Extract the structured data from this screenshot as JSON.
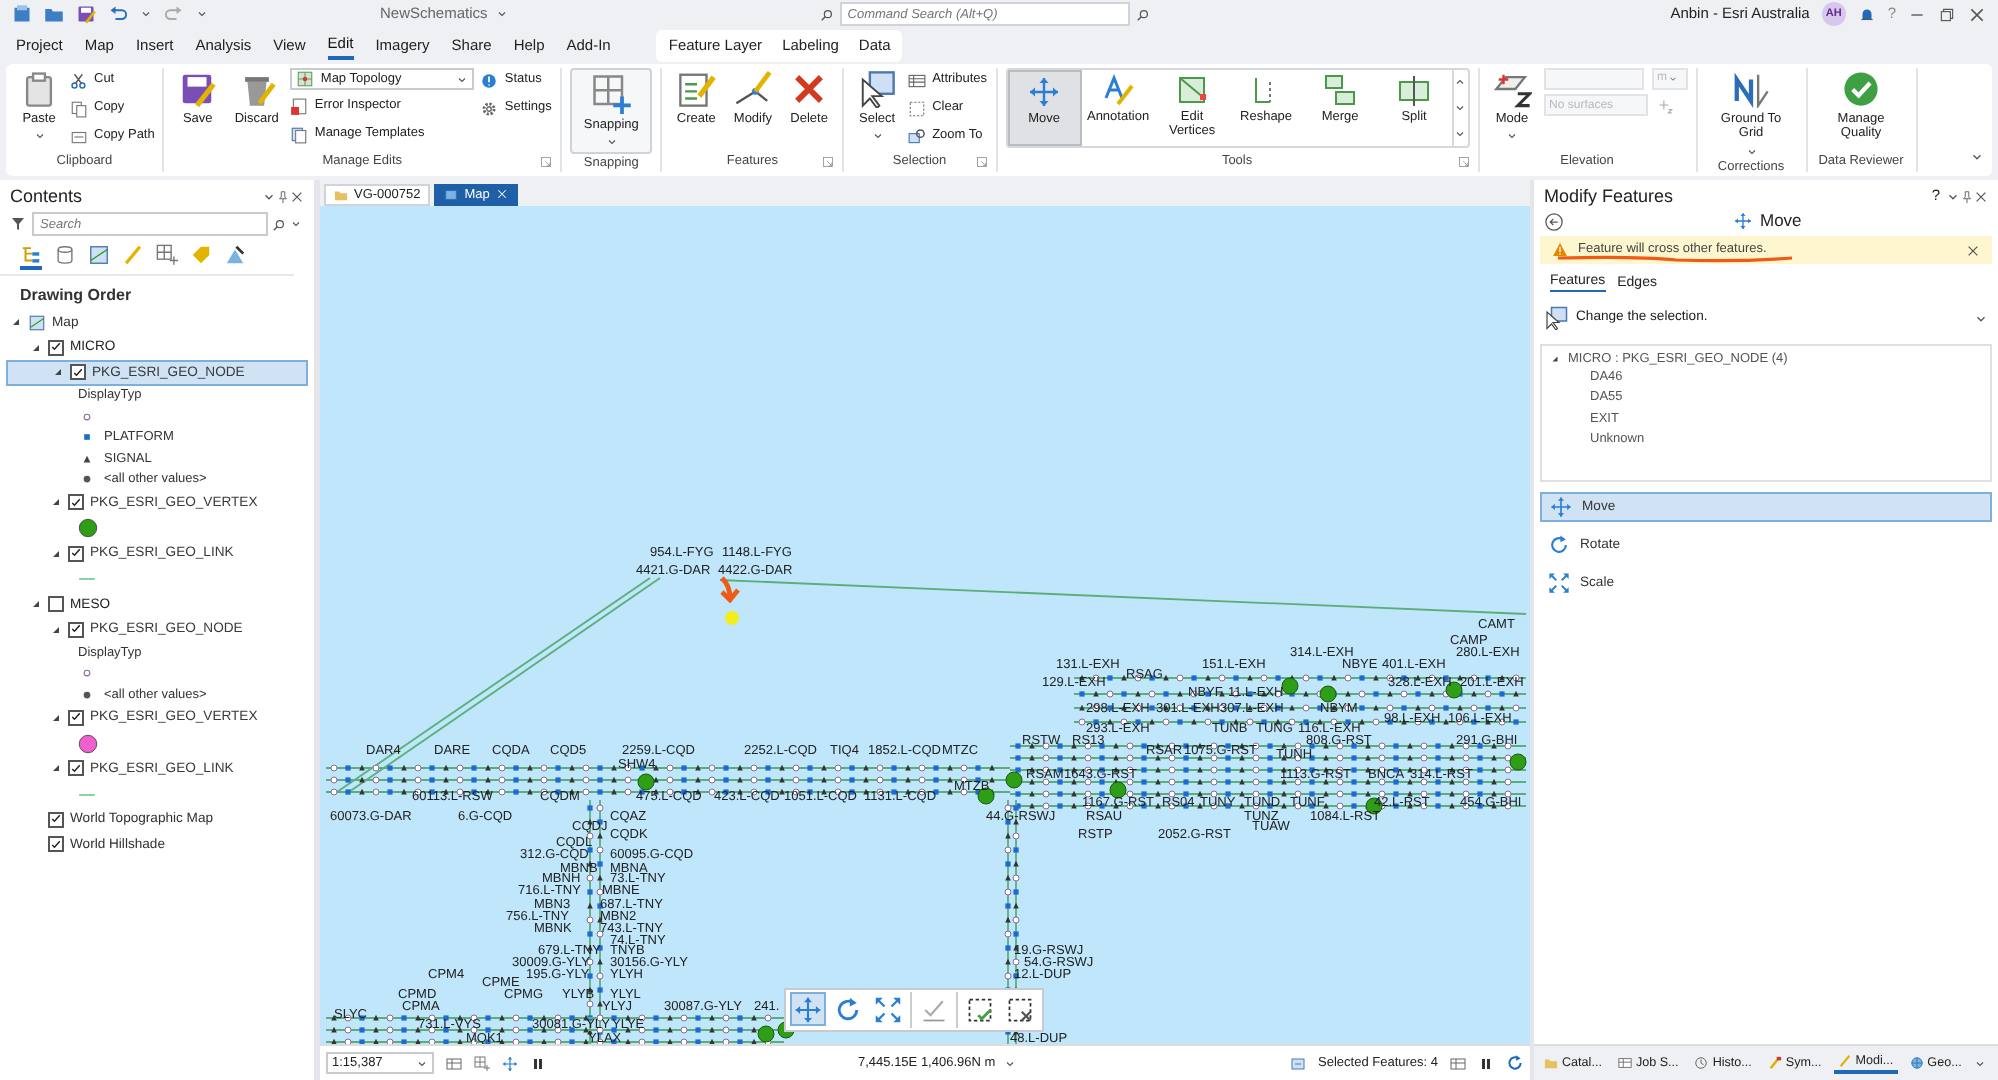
{
  "title_bar": {
    "document": "NewSchematics",
    "search": {
      "placeholder": "Command Search (Alt+Q)"
    },
    "user": "Anbin - Esri Australia",
    "avatar": "AH",
    "help": "?"
  },
  "menu_tabs": [
    {
      "label": "Project",
      "selected": false
    },
    {
      "label": "Map",
      "selected": false
    },
    {
      "label": "Insert",
      "selected": false
    },
    {
      "label": "Analysis",
      "selected": false
    },
    {
      "label": "View",
      "selected": false
    },
    {
      "label": "Edit",
      "selected": true
    },
    {
      "label": "Imagery",
      "selected": false
    },
    {
      "label": "Share",
      "selected": false
    },
    {
      "label": "Help",
      "selected": false
    },
    {
      "label": "Add-In",
      "selected": false
    }
  ],
  "contextual_tabs": [
    {
      "label": "Feature Layer",
      "selected": false
    },
    {
      "label": "Labeling",
      "selected": false
    },
    {
      "label": "Data",
      "selected": false
    }
  ],
  "ribbon": [
    {
      "label": "Clipboard",
      "launcher": false,
      "columns": [
        [
          {
            "label": "Paste",
            "kind": "large",
            "menu": true
          }
        ],
        [
          {
            "label": "Cut",
            "kind": "small"
          },
          {
            "label": "Copy",
            "kind": "small"
          },
          {
            "label": "Copy Path",
            "kind": "small"
          }
        ]
      ]
    },
    {
      "label": "Manage Edits",
      "launcher": true,
      "columns": [
        [
          {
            "label": "Save",
            "kind": "large",
            "menu": false
          }
        ],
        [
          {
            "label": "Discard",
            "kind": "large",
            "menu": false
          }
        ],
        [
          {
            "label": "Map Topology",
            "kind": "combo"
          },
          {
            "label": "Error Inspector",
            "kind": "small"
          },
          {
            "label": "Manage Templates",
            "kind": "small"
          }
        ],
        [
          {
            "label": "Status",
            "kind": "small"
          },
          {
            "label": "Settings",
            "kind": "small"
          }
        ]
      ]
    },
    {
      "label": "Snapping",
      "launcher": false,
      "columns": [
        [
          {
            "label": "Snapping",
            "kind": "split",
            "menu": true
          }
        ]
      ]
    },
    {
      "label": "Features",
      "launcher": true,
      "columns": [
        [
          {
            "label": "Create",
            "kind": "large",
            "menu": false
          }
        ],
        [
          {
            "label": "Modify",
            "kind": "large",
            "menu": false
          }
        ],
        [
          {
            "label": "Delete",
            "kind": "large",
            "menu": false
          }
        ]
      ]
    },
    {
      "label": "Selection",
      "launcher": true,
      "columns": [
        [
          {
            "label": "Select",
            "kind": "large",
            "menu": true
          }
        ],
        [
          {
            "label": "Attributes",
            "kind": "small"
          },
          {
            "label": "Clear",
            "kind": "small"
          },
          {
            "label": "Zoom To",
            "kind": "small"
          }
        ]
      ]
    },
    {
      "label": "Tools",
      "launcher": true,
      "gallery": [
        {
          "label": "Move",
          "selected": true
        },
        {
          "label": "Annotation",
          "selected": false
        },
        {
          "label": "Edit Vertices",
          "selected": false
        },
        {
          "label": "Reshape",
          "selected": false
        },
        {
          "label": "Merge",
          "selected": false
        },
        {
          "label": "Split",
          "selected": false
        }
      ]
    },
    {
      "label": "Elevation",
      "launcher": false,
      "columns": [
        [
          {
            "label": "Mode",
            "kind": "large",
            "menu": true
          }
        ],
        [
          {
            "kind": "unit-field",
            "value": "m",
            "disabled": true
          },
          {
            "kind": "surface-field",
            "placeholder": "No surfaces",
            "disabled": true
          }
        ]
      ]
    },
    {
      "label": "Corrections",
      "launcher": false,
      "columns": [
        [
          {
            "label": "Ground To Grid",
            "kind": "large",
            "menu": true
          }
        ]
      ]
    },
    {
      "label": "Data Reviewer",
      "launcher": false,
      "columns": [
        [
          {
            "label": "Manage Quality",
            "kind": "large",
            "menu": false
          }
        ]
      ]
    }
  ],
  "contents": {
    "title": "Contents",
    "search": {
      "placeholder": "Search"
    },
    "heading": "Drawing Order",
    "tree": [
      {
        "kind": "map",
        "label": "Map",
        "expanded": true,
        "children": [
          {
            "kind": "group",
            "label": "MICRO",
            "checked": true,
            "expanded": true,
            "children": [
              {
                "kind": "layer",
                "label": "PKG_ESRI_GEO_NODE",
                "checked": true,
                "expanded": true,
                "selected": true,
                "legend": {
                  "heading": "DisplayTyp",
                  "items": [
                    {
                      "kind": "hollow"
                    },
                    {
                      "kind": "square",
                      "label": "PLATFORM"
                    },
                    {
                      "kind": "triangle",
                      "label": "SIGNAL"
                    },
                    {
                      "kind": "dot",
                      "label": "<all other values>"
                    }
                  ]
                }
              },
              {
                "kind": "layer",
                "label": "PKG_ESRI_GEO_VERTEX",
                "checked": true,
                "expanded": true,
                "selected": false,
                "legend": {
                  "items": [
                    {
                      "kind": "circle",
                      "color": "#2e9e16"
                    }
                  ]
                }
              },
              {
                "kind": "layer",
                "label": "PKG_ESRI_GEO_LINK",
                "checked": true,
                "expanded": true,
                "selected": false,
                "legend": {
                  "items": [
                    {
                      "kind": "line"
                    }
                  ]
                }
              }
            ]
          },
          {
            "kind": "group",
            "label": "MESO",
            "checked": false,
            "expanded": true,
            "children": [
              {
                "kind": "layer",
                "label": "PKG_ESRI_GEO_NODE",
                "checked": true,
                "expanded": true,
                "selected": false,
                "legend": {
                  "heading": "DisplayTyp",
                  "items": [
                    {
                      "kind": "hollow"
                    },
                    {
                      "kind": "dot",
                      "label": "<all other values>"
                    }
                  ]
                }
              },
              {
                "kind": "layer",
                "label": "PKG_ESRI_GEO_VERTEX",
                "checked": true,
                "expanded": true,
                "selected": false,
                "legend": {
                  "items": [
                    {
                      "kind": "circle",
                      "color": "#f060d0"
                    }
                  ]
                }
              },
              {
                "kind": "layer",
                "label": "PKG_ESRI_GEO_LINK",
                "checked": true,
                "expanded": true,
                "selected": false,
                "legend": {
                  "items": [
                    {
                      "kind": "line"
                    }
                  ]
                }
              }
            ]
          },
          {
            "kind": "basemap",
            "label": "World Topographic Map",
            "checked": true,
            "selected": false
          },
          {
            "kind": "basemap",
            "label": "World Hillshade",
            "checked": true,
            "selected": false
          }
        ]
      }
    ]
  },
  "map_tabs": [
    {
      "label": "VG-000752",
      "selected": false
    },
    {
      "label": "Map",
      "selected": true
    }
  ],
  "map_labels": [
    "954.L-FYG",
    "1148.L-FYG",
    "4421.G-DAR",
    "4422.G-DAR",
    "CAMT",
    "CAMP",
    "314.L-EXH",
    "280.L-EXH",
    "131.L-EXH",
    "151.L-EXH",
    "NBYE",
    "401.L-EXH",
    "RSAG",
    "129.L-EXH",
    "328.L-EXH",
    "201.L-EXH",
    "NBYF",
    "11.L-EXH",
    "298.L-EXH",
    "301.L-EXH",
    "307.L-EXH",
    "NBYM",
    "98.L-EXH",
    "106.L-EXH",
    "293.L-EXH",
    "TUNB",
    "TUNG",
    "116.L-EXH",
    "RSTW",
    "RS13",
    "808.G-RST",
    "291.G-BHI",
    "DAR4",
    "DARE",
    "CQDA",
    "CQD5",
    "2259.L-CQD",
    "2252.L-CQD",
    "TIQ4",
    "1852.L-CQD",
    "MTZC",
    "RSAR",
    "1075.G-RST",
    "TUNH",
    "SHW4",
    "RSAM",
    "1643.G-RST",
    "1113.G-RST",
    "BNCA",
    "314.L-RST",
    "MTZB",
    "60113.L-RSW",
    "CQDM",
    "475.L-CQD",
    "423.L-CQD",
    "1051.L-CQD",
    "1131.L-CQD",
    "1167.G-RST",
    "RS04",
    "TUNY",
    "TUND",
    "TUNF",
    "42.L-RST",
    "454.G-BHI",
    "60073.G-DAR",
    "6.G-CQD",
    "CQAZ",
    "44.G-RSWJ",
    "RSAU",
    "TUNZ",
    "1084.L-RST",
    "CQDJ",
    "TUAW",
    "CQDK",
    "RSTP",
    "2052.G-RST",
    "CQDL",
    "312.G-CQD",
    "60095.G-CQD",
    "MBNB",
    "MBNA",
    "MBNH",
    "73.L-TNY",
    "716.L-TNY",
    "MBNE",
    "MBN3",
    "687.L-TNY",
    "756.L-TNY",
    "MBN2",
    "MBNK",
    "743.L-TNY",
    "74.L-TNY",
    "679.L-TNY",
    "TNYB",
    "19.G-RSWJ",
    "30009.G-YLY",
    "30156.G-YLY",
    "54.G-RSWJ",
    "CPM4",
    "195.G-YLY",
    "YLYH",
    "12.L-DUP",
    "CPME",
    "CPMD",
    "CPMG",
    "YLYB",
    "YLYL",
    "CPMA",
    "YLYJ",
    "30087.G-YLY",
    "241.",
    "SLYC",
    "731.L-VYS",
    "30081.G-YLY",
    "YLYE",
    "MQK1",
    "YLAX",
    "48.L-DUP"
  ],
  "map_toolbar": [
    {
      "selected": true
    },
    {
      "selected": false
    },
    {
      "selected": false
    },
    {
      "selected": false
    },
    {
      "selected": false
    },
    {
      "selected": false
    }
  ],
  "status_bar": {
    "scale": "1:15,387",
    "coordinates": "7,445.15E 1,406.96N m",
    "selected_features": "Selected Features: 4"
  },
  "modify_panel": {
    "title": "Modify Features",
    "help": "?",
    "tool": "Move",
    "warning": "Feature will cross other features.",
    "tabs": [
      {
        "label": "Features",
        "selected": true
      },
      {
        "label": "Edges",
        "selected": false
      }
    ],
    "hint": "Change the selection.",
    "selection": [
      {
        "label": "MICRO : PKG_ESRI_GEO_NODE (4)",
        "expanded": true,
        "children": [
          "DA46",
          "DA55",
          "EXIT",
          "Unknown"
        ]
      }
    ],
    "tools": [
      {
        "label": "Move",
        "selected": true
      },
      {
        "label": "Rotate",
        "selected": false
      },
      {
        "label": "Scale",
        "selected": false
      }
    ]
  },
  "dock_tabs": [
    {
      "label": "Catal...",
      "selected": false
    },
    {
      "label": "Job S...",
      "selected": false
    },
    {
      "label": "Histo...",
      "selected": false
    },
    {
      "label": "Sym...",
      "selected": false
    },
    {
      "label": "Modi...",
      "selected": true
    },
    {
      "label": "Geo...",
      "selected": false
    }
  ]
}
